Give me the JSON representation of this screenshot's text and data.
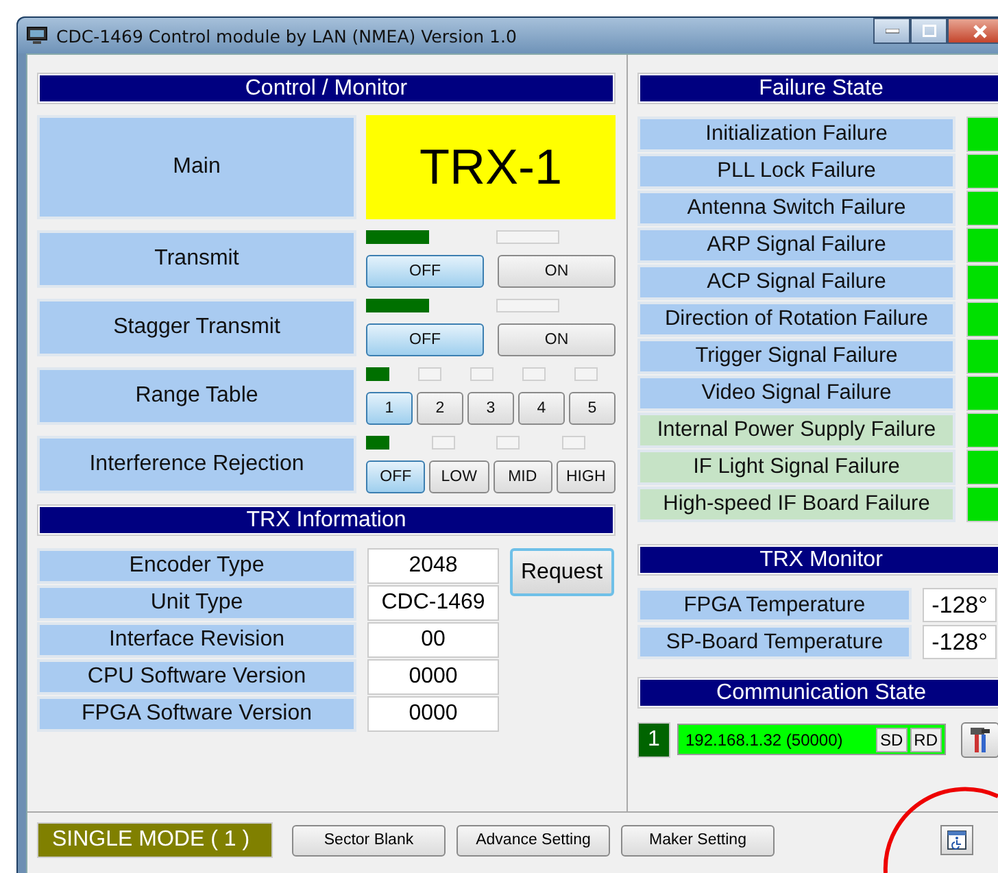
{
  "window": {
    "title": "CDC-1469 Control module by LAN (NMEA) Version 1.0"
  },
  "control_monitor": {
    "title": "Control / Monitor",
    "main": {
      "label": "Main",
      "value": "TRX-1"
    },
    "controls": [
      {
        "label": "Transmit",
        "lamps": [
          {
            "on": true
          },
          {
            "on": false
          }
        ],
        "buttons": [
          {
            "label": "OFF",
            "selected": true
          },
          {
            "label": "ON",
            "selected": false
          }
        ]
      },
      {
        "label": "Stagger Transmit",
        "lamps": [
          {
            "on": true
          },
          {
            "on": false
          }
        ],
        "buttons": [
          {
            "label": "OFF",
            "selected": true
          },
          {
            "label": "ON",
            "selected": false
          }
        ]
      },
      {
        "label": "Range Table",
        "lamps": [
          {
            "on": true
          },
          {
            "on": false
          },
          {
            "on": false
          },
          {
            "on": false
          },
          {
            "on": false
          }
        ],
        "buttons": [
          {
            "label": "1",
            "selected": true
          },
          {
            "label": "2",
            "selected": false
          },
          {
            "label": "3",
            "selected": false
          },
          {
            "label": "4",
            "selected": false
          },
          {
            "label": "5",
            "selected": false
          }
        ]
      },
      {
        "label": "Interference Rejection",
        "lamps": [
          {
            "on": true
          },
          {
            "on": false
          },
          {
            "on": false
          },
          {
            "on": false
          }
        ],
        "buttons": [
          {
            "label": "OFF",
            "selected": true
          },
          {
            "label": "LOW",
            "selected": false
          },
          {
            "label": "MID",
            "selected": false
          },
          {
            "label": "HIGH",
            "selected": false
          }
        ]
      }
    ]
  },
  "trx_information": {
    "title": "TRX Information",
    "request_button": "Request",
    "rows": [
      {
        "label": "Encoder Type",
        "value": "2048"
      },
      {
        "label": "Unit Type",
        "value": "CDC-1469"
      },
      {
        "label": "Interface Revision",
        "value": "00"
      },
      {
        "label": "CPU Software Version",
        "value": "0000"
      },
      {
        "label": "FPGA Software Version",
        "value": "0000"
      }
    ]
  },
  "failure_state": {
    "title": "Failure State",
    "items": [
      {
        "label": "Initialization Failure",
        "color": "#a9cbf1"
      },
      {
        "label": "PLL Lock Failure",
        "color": "#a9cbf1"
      },
      {
        "label": "Antenna Switch Failure",
        "color": "#a9cbf1"
      },
      {
        "label": "ARP Signal Failure",
        "color": "#a9cbf1"
      },
      {
        "label": "ACP Signal Failure",
        "color": "#a9cbf1"
      },
      {
        "label": "Direction of Rotation Failure",
        "color": "#a9cbf1"
      },
      {
        "label": "Trigger Signal Failure",
        "color": "#a9cbf1"
      },
      {
        "label": "Video Signal Failure",
        "color": "#a9cbf1"
      },
      {
        "label": "Internal Power Supply Failure",
        "color": "#c6e3c6"
      },
      {
        "label": "IF Light Signal Failure",
        "color": "#c6e3c6"
      },
      {
        "label": "High-speed IF Board Failure",
        "color": "#c6e3c6"
      }
    ]
  },
  "trx_monitor": {
    "title": "TRX Monitor",
    "rows": [
      {
        "label": "FPGA Temperature",
        "value": "-128°"
      },
      {
        "label": "SP-Board Temperature",
        "value": "-128°"
      }
    ]
  },
  "communication_state": {
    "title": "Communication State",
    "channel": "1",
    "address": "192.168.1.32 (50000)",
    "flags": [
      "SD",
      "RD"
    ]
  },
  "bottom_bar": {
    "mode": "SINGLE MODE ( 1 )",
    "buttons": [
      "Sector Blank",
      "Advance Setting",
      "Maker Setting"
    ]
  }
}
